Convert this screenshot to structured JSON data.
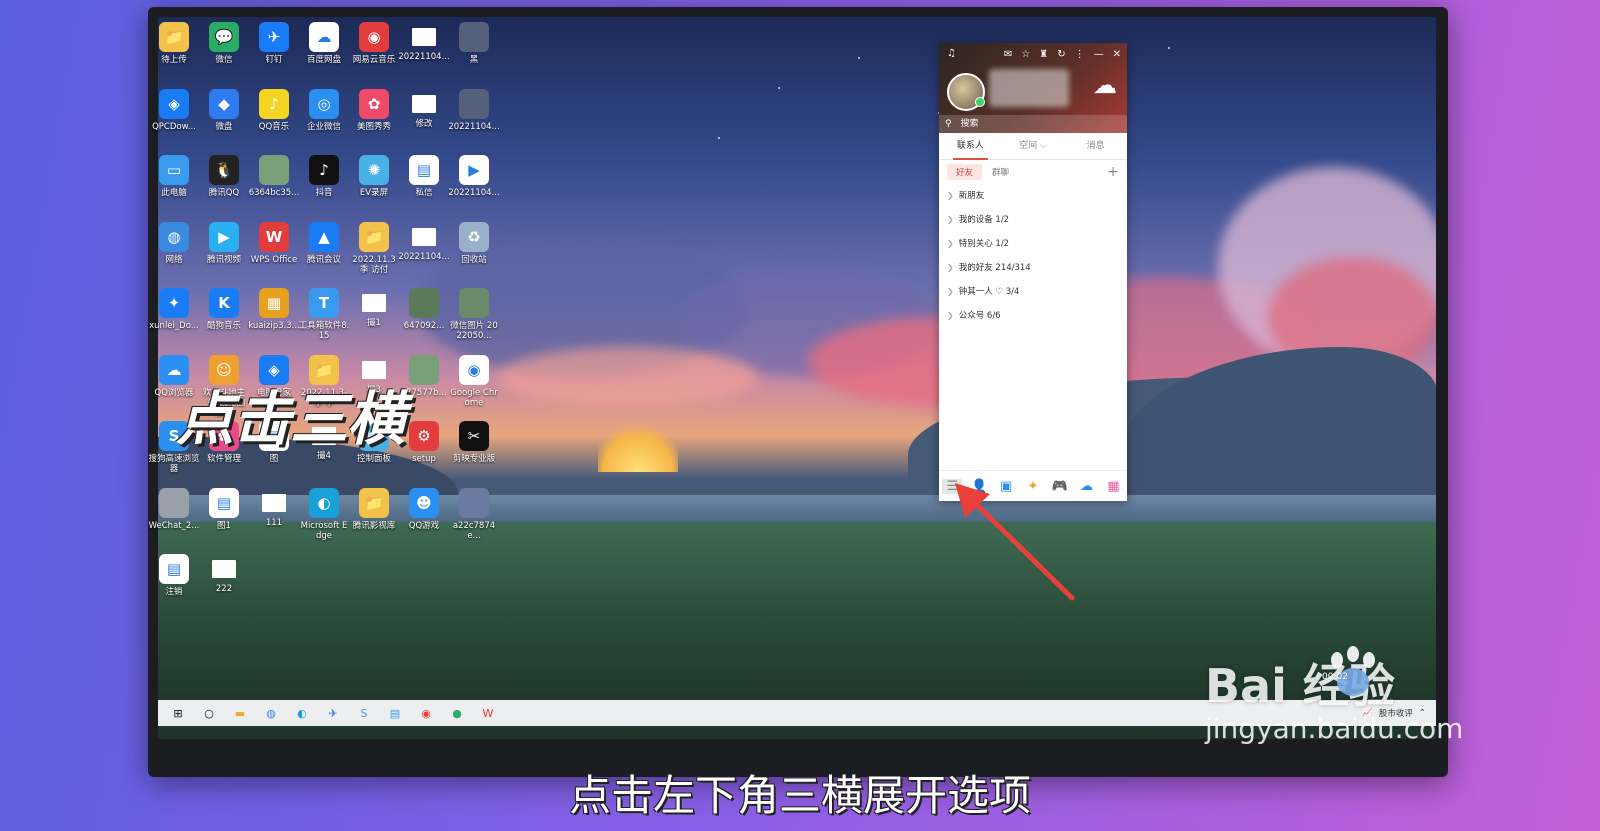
{
  "desktop_icons": [
    {
      "label": "待上传",
      "color": "#f2c24a",
      "glyph": "📁"
    },
    {
      "label": "微信",
      "color": "#2aae67",
      "glyph": "💬"
    },
    {
      "label": "钉钉",
      "color": "#1a7cf5",
      "glyph": "✈"
    },
    {
      "label": "百度网盘",
      "color": "#ffffff",
      "glyph": "☁"
    },
    {
      "label": "网易云音乐",
      "color": "#e23c3c",
      "glyph": "◉"
    },
    {
      "label": "20221104...",
      "color": "blank",
      "glyph": ""
    },
    {
      "label": "黑",
      "color": "#55607a",
      "glyph": ""
    },
    {
      "label": "QPCDow...",
      "color": "#1a7cf5",
      "glyph": "◈"
    },
    {
      "label": "微盘",
      "color": "#2f7cf0",
      "glyph": "◆"
    },
    {
      "label": "QQ音乐",
      "color": "#f5d523",
      "glyph": "♪"
    },
    {
      "label": "企业微信",
      "color": "#2a8ff0",
      "glyph": "◎"
    },
    {
      "label": "美图秀秀",
      "color": "#f04a6a",
      "glyph": "✿"
    },
    {
      "label": "修改",
      "color": "blank",
      "glyph": ""
    },
    {
      "label": "20221104...",
      "color": "#55607a",
      "glyph": ""
    },
    {
      "label": "此电脑",
      "color": "#3a9af0",
      "glyph": "▭"
    },
    {
      "label": "腾讯QQ",
      "color": "#222222",
      "glyph": "🐧"
    },
    {
      "label": "6364bc35...",
      "color": "#7aa07a",
      "glyph": ""
    },
    {
      "label": "抖音",
      "color": "#111111",
      "glyph": "♪"
    },
    {
      "label": "EV录屏",
      "color": "#4ab0e8",
      "glyph": "✺"
    },
    {
      "label": "私信",
      "color": "#ffffff",
      "glyph": "▤"
    },
    {
      "label": "20221104...",
      "color": "#ffffff",
      "glyph": "▶"
    },
    {
      "label": "网络",
      "color": "#3a8ae0",
      "glyph": "◍"
    },
    {
      "label": "腾讯视频",
      "color": "#2ab0f0",
      "glyph": "▶"
    },
    {
      "label": "WPS Office",
      "color": "#e23c3c",
      "glyph": "W"
    },
    {
      "label": "腾讯会议",
      "color": "#1a7cf5",
      "glyph": "▲"
    },
    {
      "label": "2022.11.3 季 访付",
      "color": "#f2c24a",
      "glyph": "📁"
    },
    {
      "label": "20221104...",
      "color": "blank",
      "glyph": ""
    },
    {
      "label": "回收站",
      "color": "#9ab0c8",
      "glyph": "♻"
    },
    {
      "label": "xunlei_Do...",
      "color": "#1a7cf5",
      "glyph": "✦"
    },
    {
      "label": "酷狗音乐",
      "color": "#1a7cf5",
      "glyph": "K"
    },
    {
      "label": "kuaizip3.3...",
      "color": "#e8a020",
      "glyph": "▦"
    },
    {
      "label": "工具箱软件8.15",
      "color": "#3a9af0",
      "glyph": "T"
    },
    {
      "label": "撮1",
      "color": "blank",
      "glyph": ""
    },
    {
      "label": "647092...",
      "color": "#5a7a5a",
      "glyph": ""
    },
    {
      "label": "微信图片 2022050...",
      "color": "#6a8a6a",
      "glyph": ""
    },
    {
      "label": "QQ浏览器",
      "color": "#2a8ff0",
      "glyph": "☁"
    },
    {
      "label": "欢乐斗地主（手游电脑版）",
      "color": "#f0a030",
      "glyph": "☺"
    },
    {
      "label": "电脑管家",
      "color": "#1a7cf5",
      "glyph": "◈"
    },
    {
      "label": "2022.11.3-季 季",
      "color": "#f2c24a",
      "glyph": "📁"
    },
    {
      "label": "撮3",
      "color": "blank",
      "glyph": ""
    },
    {
      "label": "c77577b...",
      "color": "#7aa07a",
      "glyph": ""
    },
    {
      "label": "Google Chrome",
      "color": "#ffffff",
      "glyph": "◉"
    },
    {
      "label": "搜狗高速浏览器",
      "color": "#2a8ff0",
      "glyph": "S"
    },
    {
      "label": "软件管理",
      "color": "#e84a8a",
      "glyph": "✿"
    },
    {
      "label": "图",
      "color": "#ffffff",
      "glyph": "▤"
    },
    {
      "label": "撮4",
      "color": "blank",
      "glyph": ""
    },
    {
      "label": "控制面板",
      "color": "#4ab0e8",
      "glyph": "▦"
    },
    {
      "label": "setup",
      "color": "#e23c3c",
      "glyph": "⚙"
    },
    {
      "label": "剪映专业版",
      "color": "#111111",
      "glyph": "✂"
    },
    {
      "label": "WeChat_2...",
      "color": "#9aa0a8",
      "glyph": ""
    },
    {
      "label": "图1",
      "color": "#ffffff",
      "glyph": "▤"
    },
    {
      "label": "111",
      "color": "blank",
      "glyph": ""
    },
    {
      "label": "Microsoft Edge",
      "color": "#1aa0d8",
      "glyph": "◐"
    },
    {
      "label": "腾讯影视库",
      "color": "#f2c24a",
      "glyph": "📁"
    },
    {
      "label": "QQ游戏",
      "color": "#2a8ff0",
      "glyph": "☻"
    },
    {
      "label": "a22c7874e...",
      "color": "#6a7aa0",
      "glyph": ""
    },
    {
      "label": "注销",
      "color": "#ffffff",
      "glyph": "▤"
    },
    {
      "label": "222",
      "color": "blank",
      "glyph": ""
    }
  ],
  "overlay_caption": "点击三横",
  "qq": {
    "search_placeholder": "搜索",
    "tabs": [
      "联系人",
      "空间 ⌵",
      "消息"
    ],
    "subtabs": {
      "friends": "好友",
      "groups": "群聊"
    },
    "groups": [
      "新朋友",
      "我的设备  1/2",
      "特别关心  1/2",
      "我的好友  214/314",
      "钟其一人 ♡  3/4",
      "公众号  6/6"
    ]
  },
  "taskbar": {
    "tray_text": "股市收评"
  },
  "subtitle": "点击左下角三横展开选项",
  "watermark": {
    "logo": "Bai  经验",
    "url": "jingyan.baidu.com",
    "time": "00:02"
  }
}
